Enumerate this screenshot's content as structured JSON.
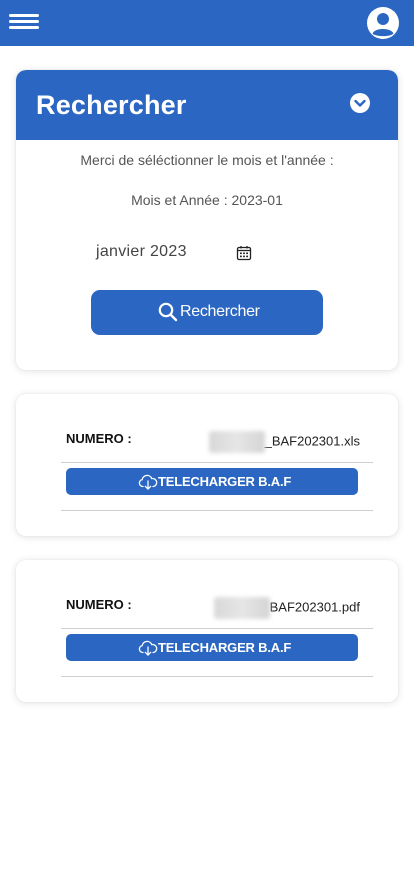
{
  "header": {
    "menu_icon": "hamburger-menu-icon",
    "profile_icon": "user-account-icon",
    "color": "#2b67c2"
  },
  "search": {
    "title": "Rechercher",
    "collapse_icon": "chevron-down-circle-icon",
    "instruction": "Merci de séléctionner le mois et l'année :",
    "month_year_line": "Mois et Année : 2023-01",
    "date_input_value": "janvier 2023",
    "calendar_icon": "calendar-icon",
    "button_label": "Rechercher",
    "button_icon": "search-icon"
  },
  "results": [
    {
      "numero_label": "NUMERO :",
      "file_suffix": "_BAF202301.xls",
      "download_label": "TELECHARGER B.A.F",
      "download_icon": "cloud-download-icon"
    },
    {
      "numero_label": "NUMERO :",
      "file_suffix": "BAF202301.pdf",
      "download_label": "TELECHARGER B.A.F",
      "download_icon": "cloud-download-icon"
    }
  ]
}
